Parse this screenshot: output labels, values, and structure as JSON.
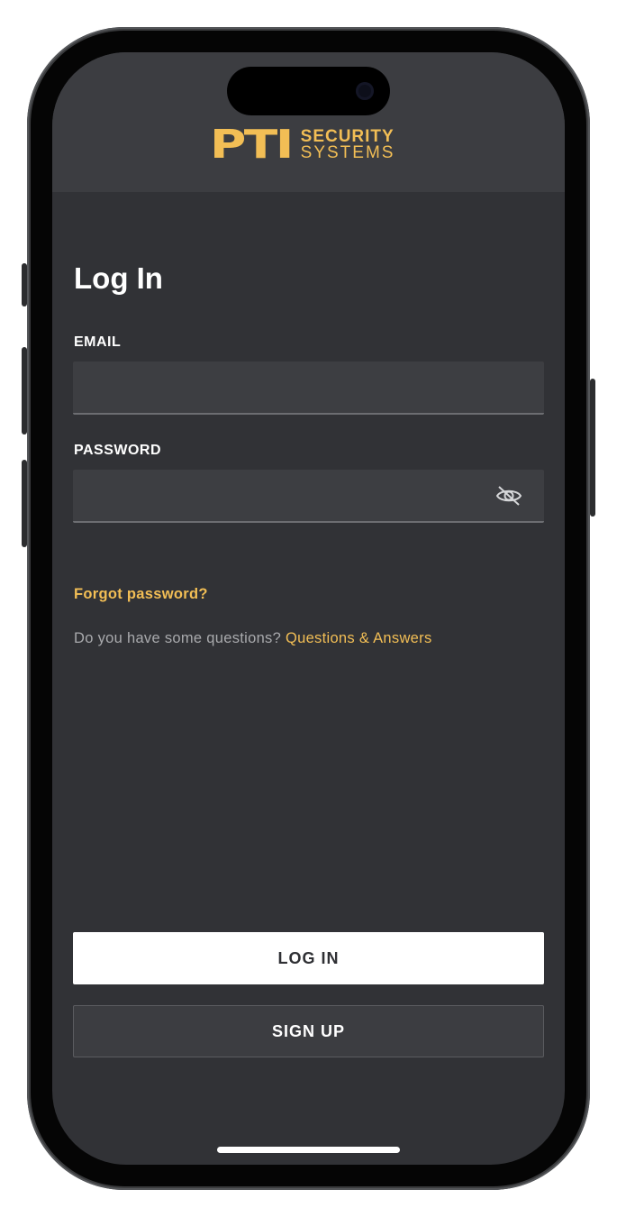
{
  "brand": {
    "logo_mark": "PTI",
    "logo_line1": "SECURITY",
    "logo_line2": "SYSTEMS",
    "accent_color": "#f2be55"
  },
  "login": {
    "title": "Log In",
    "email_label": "EMAIL",
    "email_value": "",
    "password_label": "PASSWORD",
    "password_value": "",
    "password_toggle_icon": "eye-slash-icon",
    "forgot_link": "Forgot password?",
    "faq_prompt": "Do you have some questions?",
    "faq_link": "Questions & Answers",
    "login_button": "LOG IN",
    "signup_button": "SIGN UP"
  }
}
